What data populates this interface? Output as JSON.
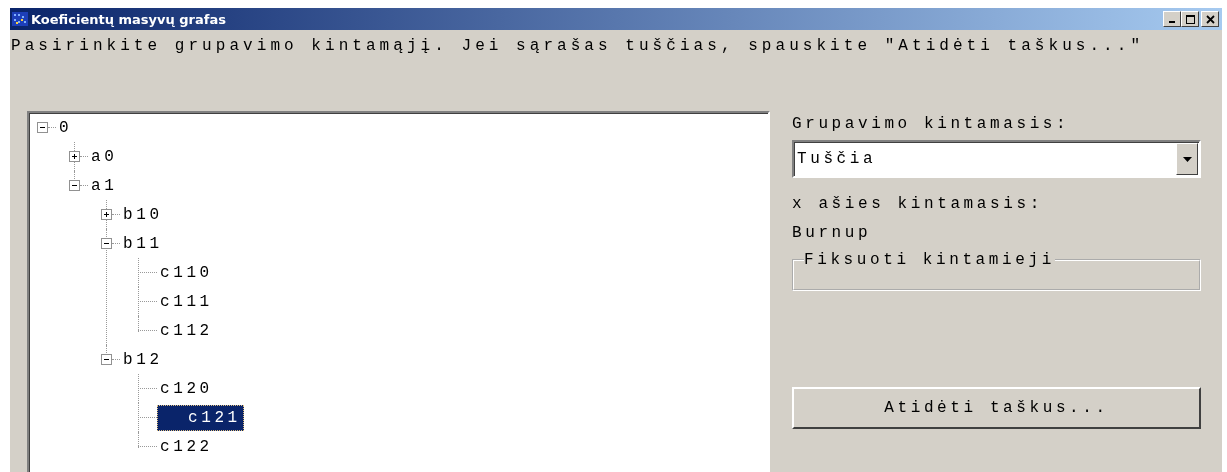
{
  "window": {
    "title": "Koeficientų masyvų grafas",
    "controls": [
      {
        "kind": "minimize"
      },
      {
        "kind": "maximize"
      },
      {
        "kind": "close"
      }
    ]
  },
  "instruction": "Pasirinkite grupavimo kintamąjį. Jei sąrašas tuščias, spauskite \"Atidėti taškus...\"",
  "tree": [
    {
      "label": "0",
      "kind": "node",
      "expanded": true,
      "selected": false,
      "children": [
        {
          "label": "a0",
          "kind": "node",
          "expanded": false,
          "selected": false
        },
        {
          "label": "a1",
          "kind": "node",
          "expanded": true,
          "selected": false,
          "children": [
            {
              "label": "b10",
              "kind": "node",
              "expanded": false,
              "selected": false
            },
            {
              "label": "b11",
              "kind": "node",
              "expanded": true,
              "selected": false,
              "children": [
                {
                  "label": "c110",
                  "kind": "leaf",
                  "selected": false
                },
                {
                  "label": "c111",
                  "kind": "leaf",
                  "selected": false
                },
                {
                  "label": "c112",
                  "kind": "leaf",
                  "selected": false
                }
              ]
            },
            {
              "label": "b12",
              "kind": "node",
              "expanded": true,
              "selected": false,
              "children": [
                {
                  "label": "c120",
                  "kind": "leaf",
                  "selected": false
                },
                {
                  "label": "c121",
                  "kind": "leaf",
                  "selected": true
                },
                {
                  "label": "c122",
                  "kind": "leaf",
                  "selected": false
                }
              ]
            }
          ]
        }
      ]
    }
  ],
  "grouping": {
    "label": "Grupavimo kintamasis:",
    "value": "Tuščia"
  },
  "x_axis": {
    "label": "x ašies kintamasis:",
    "value": "Burnup"
  },
  "fixed_group": {
    "title": "Fiksuoti kintamieji"
  },
  "buttons": [
    "Atidėti taškus..."
  ]
}
